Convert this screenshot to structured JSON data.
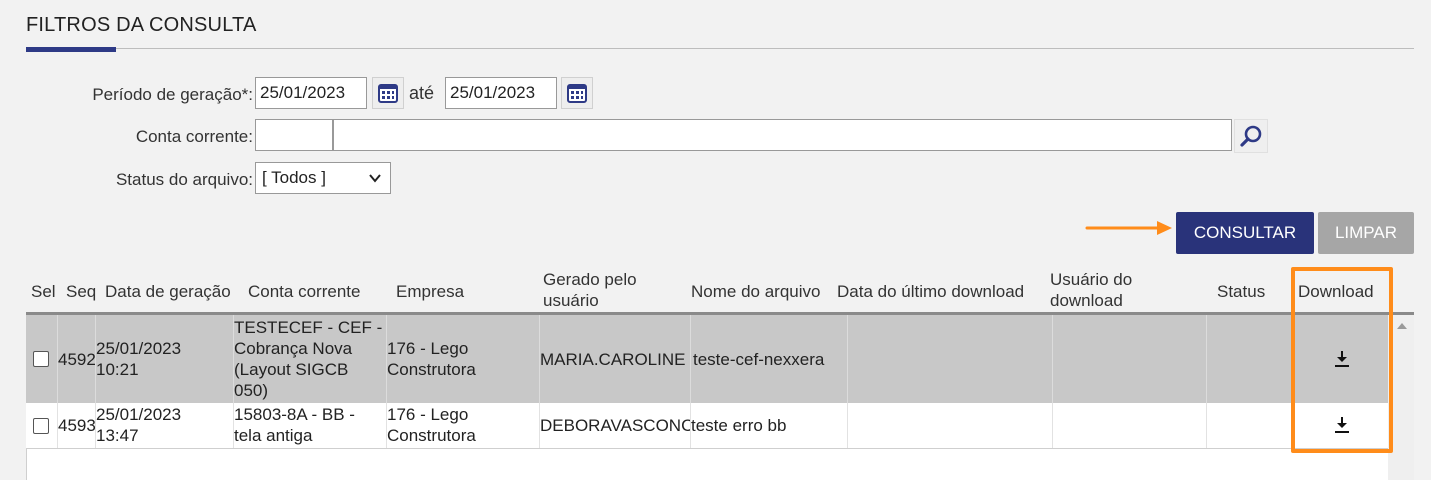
{
  "section": {
    "title": "FILTROS DA CONSULTA"
  },
  "filters": {
    "periodo_label": "Período de geração*:",
    "date_from": "25/01/2023",
    "ate_label": "até",
    "date_to": "25/01/2023",
    "conta_label": "Conta corrente:",
    "conta_code": "",
    "conta_name": "",
    "status_label": "Status do arquivo:",
    "status_selected": "[ Todos ]"
  },
  "actions": {
    "consultar": "CONSULTAR",
    "limpar": "LIMPAR"
  },
  "table": {
    "headers": {
      "sel": "Sel",
      "seq": "Seq",
      "data_geracao": "Data de geração",
      "conta": "Conta corrente",
      "empresa": "Empresa",
      "gerado_1": "Gerado pelo",
      "gerado_2": "usuário",
      "nome": "Nome do arquivo",
      "ultimo_download": "Data do último download",
      "usuario_1": "Usuário do",
      "usuario_2": "download",
      "status": "Status",
      "download": "Download"
    },
    "rows": [
      {
        "seq": "4592",
        "date": "25/01/2023",
        "time": "10:21",
        "conta_lines": [
          "TESTECEF - CEF -",
          "Cobrança Nova",
          "(Layout SIGCB",
          "050)"
        ],
        "empresa_lines": [
          "176 - Lego",
          "Construtora"
        ],
        "gerado": "MARIA.CAROLINE",
        "nome": "teste-cef-nexxera",
        "ultimo_download": "",
        "usuario": "",
        "status": ""
      },
      {
        "seq": "4593",
        "date": "25/01/2023",
        "time": "13:47",
        "conta_lines": [
          "15803-8A - BB -",
          "tela antiga"
        ],
        "empresa_lines": [
          "176 - Lego",
          "Construtora"
        ],
        "gerado": "DEBORAVASCONC",
        "nome": "teste erro bb",
        "ultimo_download": "",
        "usuario": "",
        "status": ""
      }
    ]
  },
  "colors": {
    "accent": "#2e3a86",
    "primary_button": "#29337a",
    "secondary_button": "#a6a6a6",
    "annotation": "#ff8c1a",
    "selected_row": "#c8c8c8"
  },
  "icons": {
    "calendar": "calendar-icon",
    "search": "search-icon",
    "download": "download-icon",
    "chevron": "chevron-down-icon"
  }
}
